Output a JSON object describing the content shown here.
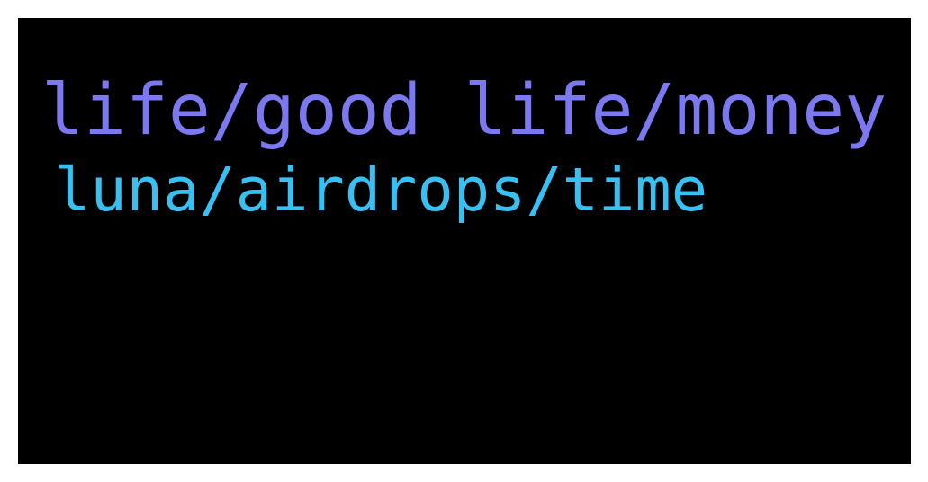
{
  "colors": {
    "background": "#000000",
    "frame": "#ffffff",
    "line1": "#7b78f0",
    "line2": "#38c0f2"
  },
  "lines": [
    {
      "text": "life/good life/money"
    },
    {
      "text": "luna/airdrops/time"
    }
  ]
}
